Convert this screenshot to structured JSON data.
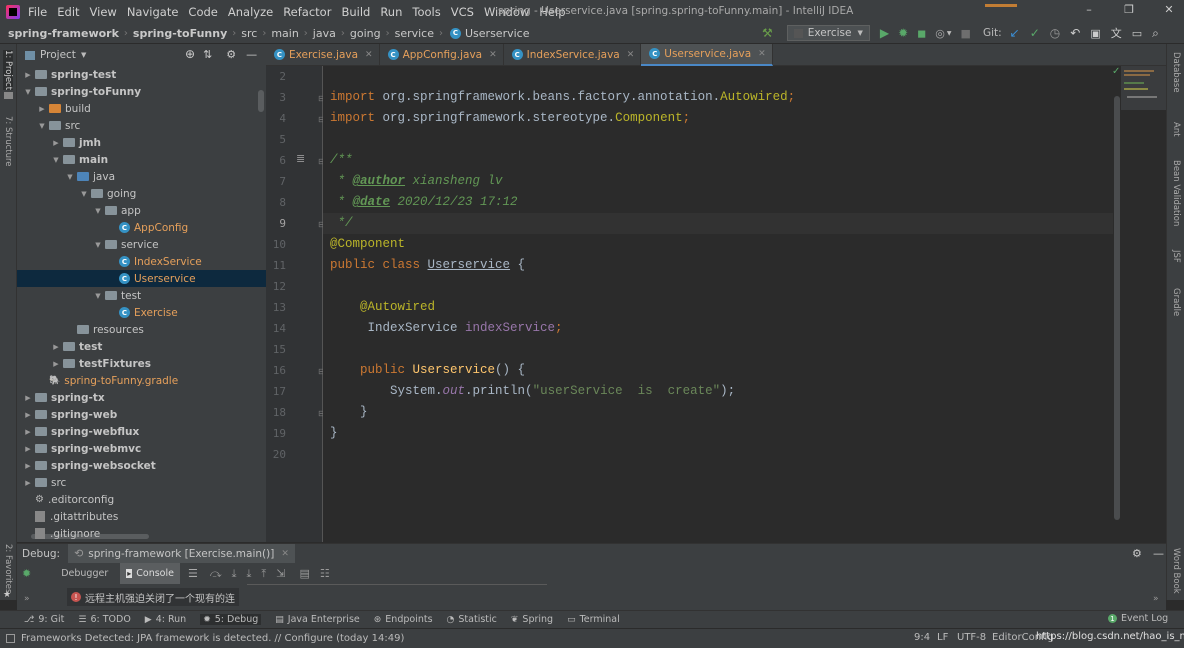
{
  "menu": {
    "items": [
      "File",
      "Edit",
      "View",
      "Navigate",
      "Code",
      "Analyze",
      "Refactor",
      "Build",
      "Run",
      "Tools",
      "VCS",
      "Window",
      "Help"
    ],
    "window_title": "spring - Userservice.java [spring.spring-toFunny.main] - IntelliJ IDEA"
  },
  "breadcrumb": [
    "spring-framework",
    "spring-toFunny",
    "src",
    "main",
    "java",
    "going",
    "service",
    "Userservice"
  ],
  "toolbar": {
    "run_config": "Exercise",
    "git_label": "Git:"
  },
  "project_panel": {
    "title": "Project",
    "tree": [
      {
        "label": "spring-test",
        "level": 1,
        "arrow": "right",
        "icon": "folder",
        "bold": true
      },
      {
        "label": "spring-toFunny",
        "level": 1,
        "arrow": "down",
        "icon": "folder",
        "bold": true
      },
      {
        "label": "build",
        "level": 2,
        "arrow": "right",
        "icon": "folder-orange"
      },
      {
        "label": "src",
        "level": 2,
        "arrow": "down",
        "icon": "folder"
      },
      {
        "label": "jmh",
        "level": 3,
        "arrow": "right",
        "icon": "folder",
        "bold": true
      },
      {
        "label": "main",
        "level": 3,
        "arrow": "down",
        "icon": "folder",
        "bold": true
      },
      {
        "label": "java",
        "level": 4,
        "arrow": "down",
        "icon": "folder-blue"
      },
      {
        "label": "going",
        "level": 5,
        "arrow": "down",
        "icon": "folder"
      },
      {
        "label": "app",
        "level": 6,
        "arrow": "down",
        "icon": "folder"
      },
      {
        "label": "AppConfig",
        "level": 7,
        "arrow": "",
        "icon": "class",
        "orange": true
      },
      {
        "label": "service",
        "level": 6,
        "arrow": "down",
        "icon": "folder"
      },
      {
        "label": "IndexService",
        "level": 7,
        "arrow": "",
        "icon": "class",
        "orange": true
      },
      {
        "label": "Userservice",
        "level": 7,
        "arrow": "",
        "icon": "class",
        "orange": true,
        "selected": true
      },
      {
        "label": "test",
        "level": 6,
        "arrow": "down",
        "icon": "folder"
      },
      {
        "label": "Exercise",
        "level": 7,
        "arrow": "",
        "icon": "class",
        "orange": true
      },
      {
        "label": "resources",
        "level": 4,
        "arrow": "",
        "icon": "folder"
      },
      {
        "label": "test",
        "level": 3,
        "arrow": "right",
        "icon": "folder",
        "bold": true
      },
      {
        "label": "testFixtures",
        "level": 3,
        "arrow": "right",
        "icon": "folder",
        "bold": true
      },
      {
        "label": "spring-toFunny.gradle",
        "level": 2,
        "arrow": "",
        "icon": "gradle",
        "orange": true
      },
      {
        "label": "spring-tx",
        "level": 1,
        "arrow": "right",
        "icon": "folder",
        "bold": true
      },
      {
        "label": "spring-web",
        "level": 1,
        "arrow": "right",
        "icon": "folder",
        "bold": true
      },
      {
        "label": "spring-webflux",
        "level": 1,
        "arrow": "right",
        "icon": "folder",
        "bold": true
      },
      {
        "label": "spring-webmvc",
        "level": 1,
        "arrow": "right",
        "icon": "folder",
        "bold": true
      },
      {
        "label": "spring-websocket",
        "level": 1,
        "arrow": "right",
        "icon": "folder",
        "bold": true
      },
      {
        "label": "src",
        "level": 1,
        "arrow": "right",
        "icon": "folder"
      },
      {
        "label": ".editorconfig",
        "level": 1,
        "arrow": "",
        "icon": "gear"
      },
      {
        "label": ".gitattributes",
        "level": 1,
        "arrow": "",
        "icon": "file"
      },
      {
        "label": ".gitignore",
        "level": 1,
        "arrow": "",
        "icon": "file"
      }
    ]
  },
  "tabs": [
    {
      "label": "Exercise.java",
      "active": false
    },
    {
      "label": "AppConfig.java",
      "active": false
    },
    {
      "label": "IndexService.java",
      "active": false
    },
    {
      "label": "Userservice.java",
      "active": true
    }
  ],
  "editor": {
    "line_numbers": [
      "2",
      "3",
      "4",
      "5",
      "6",
      "7",
      "8",
      "9",
      "10",
      "11",
      "12",
      "13",
      "14",
      "15",
      "16",
      "17",
      "18",
      "19",
      "20"
    ],
    "current_line": "9",
    "code": {
      "l3_import": "import",
      "l3_pkg": " org.springframework.beans.factory.annotation.",
      "l3_cls": "Autowired",
      "l4_import": "import",
      "l4_pkg": " org.springframework.stereotype.",
      "l4_cls": "Component",
      "l6": "/**",
      "l7_star": " * ",
      "l7_tag": "@author",
      "l7_text": " xiansheng lv",
      "l8_star": " * ",
      "l8_tag": "@date",
      "l8_text": " 2020/12/23 17:12",
      "l9": " */",
      "l10": "@Component",
      "l11_kw": "public class ",
      "l11_cls": "Userservice",
      "l11_rest": " {",
      "l13": "    @Autowired",
      "l14_type": "     IndexService ",
      "l14_field": "indexService",
      "l14_semi": ";",
      "l16_kw": "    public ",
      "l16_fn": "Userservice",
      "l16_rest": "() {",
      "l17_a": "        System.",
      "l17_out": "out",
      "l17_b": ".println(",
      "l17_str": "\"userService  is  create\"",
      "l17_c": ");",
      "l18": "    }",
      "l19": "}"
    }
  },
  "right_tools": [
    "Database",
    "Ant",
    "Bean Validation",
    "JSF",
    "Gradle",
    "Word Book"
  ],
  "left_tools": [
    "1: Project",
    "7: Structure",
    "2: Favorites"
  ],
  "debug": {
    "label": "Debug:",
    "session": "spring-framework [Exercise.main()]",
    "tab_debugger": "Debugger",
    "tab_console": "Console",
    "message": "远程主机强迫关闭了一个现有的连"
  },
  "tool_windows": [
    {
      "label": "9: Git",
      "icon": "git"
    },
    {
      "label": "6: TODO",
      "icon": "todo"
    },
    {
      "label": "4: Run",
      "icon": "run"
    },
    {
      "label": "5: Debug",
      "icon": "debug",
      "active": true
    },
    {
      "label": "Java Enterprise",
      "icon": "je"
    },
    {
      "label": "Endpoints",
      "icon": "endpoints"
    },
    {
      "label": "Statistic",
      "icon": "statistic"
    },
    {
      "label": "Spring",
      "icon": "spring"
    },
    {
      "label": "Terminal",
      "icon": "terminal"
    }
  ],
  "event_log": "Event Log",
  "status": {
    "message": "Frameworks Detected: JPA framework is detected. // Configure (today 14:49)",
    "position": "9:4",
    "line_sep": "LF",
    "encoding": "UTF-8",
    "config": "EditorConfig",
    "watermark": "https://blog.csdn.net/hao_is_me"
  }
}
